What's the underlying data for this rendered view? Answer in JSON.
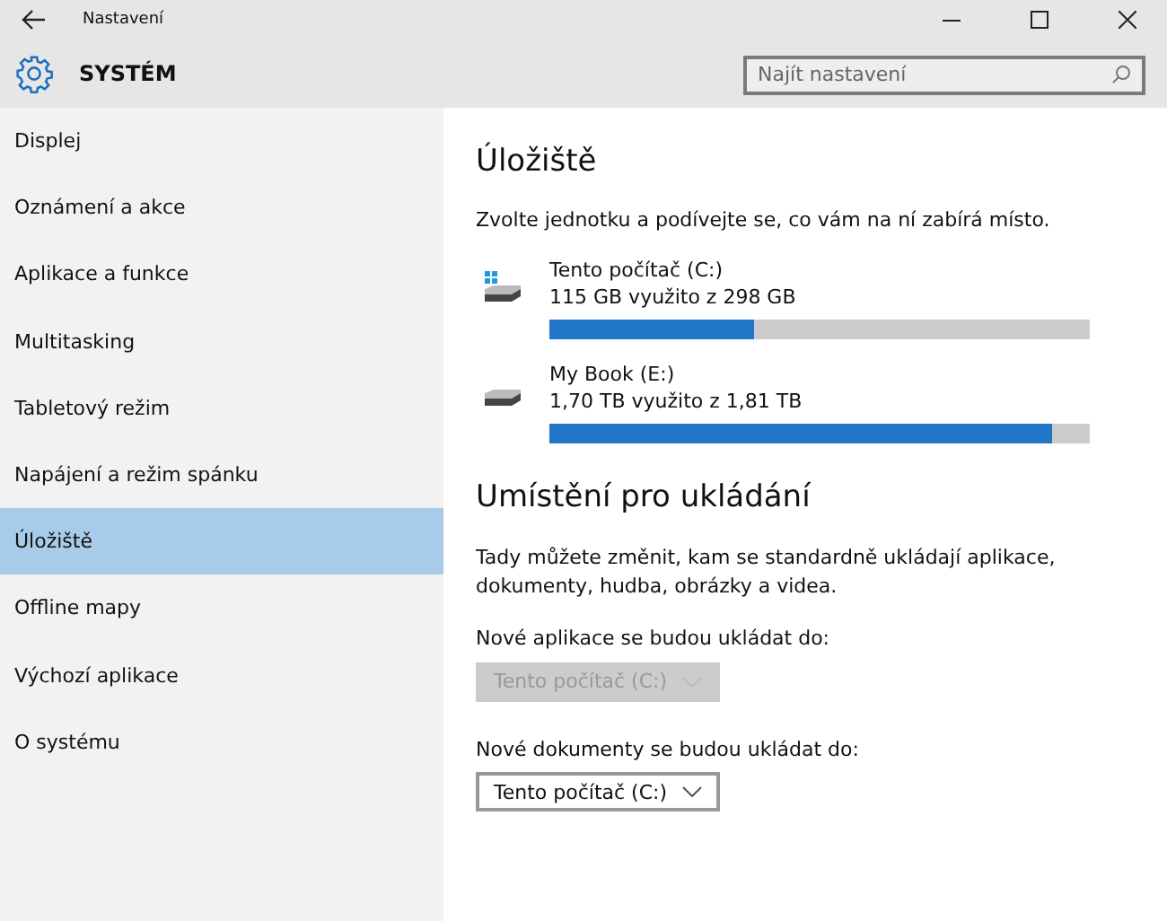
{
  "window": {
    "title": "Nastavení"
  },
  "header": {
    "title": "SYSTÉM",
    "search": {
      "placeholder": "Najít nastavení"
    }
  },
  "sidebar": {
    "items": [
      {
        "label": "Displej",
        "selected": false
      },
      {
        "label": "Oznámení a akce",
        "selected": false
      },
      {
        "label": "Aplikace a funkce",
        "selected": false
      },
      {
        "label": "Multitasking",
        "selected": false
      },
      {
        "label": "Tabletový režim",
        "selected": false
      },
      {
        "label": "Napájení a režim spánku",
        "selected": false
      },
      {
        "label": "Úložiště",
        "selected": true
      },
      {
        "label": "Offline mapy",
        "selected": false
      },
      {
        "label": "Výchozí aplikace",
        "selected": false
      },
      {
        "label": "O systému",
        "selected": false
      }
    ]
  },
  "storage": {
    "title": "Úložiště",
    "description": "Zvolte jednotku a podívejte se, co vám na ní zabírá místo.",
    "drives": [
      {
        "kind": "system",
        "name": "Tento počítač (C:)",
        "usage": "115 GB využito z 298 GB",
        "level": 0.38
      },
      {
        "kind": "external",
        "name": "My Book (E:)",
        "usage": "1,70 TB využito z 1,81 TB",
        "level": 0.93
      }
    ]
  },
  "save_locations": {
    "title": "Umístění pro ukládání",
    "description": "Tady můžete změnit, kam se standardně ukládají aplikace, dokumenty, hudba, obrázky a videa.",
    "settings": [
      {
        "label": "Nové aplikace se budou ukládat do:",
        "value": "Tento počítač (C:)",
        "disabled": true
      },
      {
        "label": "Nové dokumenty se budou ukládat do:",
        "value": "Tento počítač (C:)",
        "disabled": false
      }
    ]
  }
}
